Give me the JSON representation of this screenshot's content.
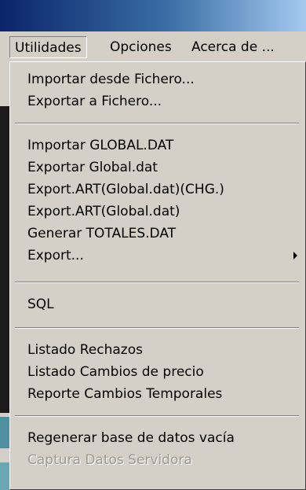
{
  "menubar": {
    "items": [
      "Utilidades",
      "Opciones",
      "Acerca de ..."
    ]
  },
  "menu": {
    "group1": [
      "Importar desde Fichero...",
      "Exportar a  Fichero..."
    ],
    "group2": [
      "Importar GLOBAL.DAT",
      "Exportar Global.dat",
      "Export.ART(Global.dat)(CHG.)",
      "Export.ART(Global.dat)",
      "Generar TOTALES.DAT",
      "Export..."
    ],
    "group3": [
      "SQL"
    ],
    "group4": [
      "Listado Rechazos",
      "Listado Cambios de precio",
      "Reporte Cambios Temporales"
    ],
    "group5": [
      "Regenerar base de datos vacía",
      "Captura Datos Servidora"
    ]
  },
  "submenu_icon": "right-triangle-icon"
}
